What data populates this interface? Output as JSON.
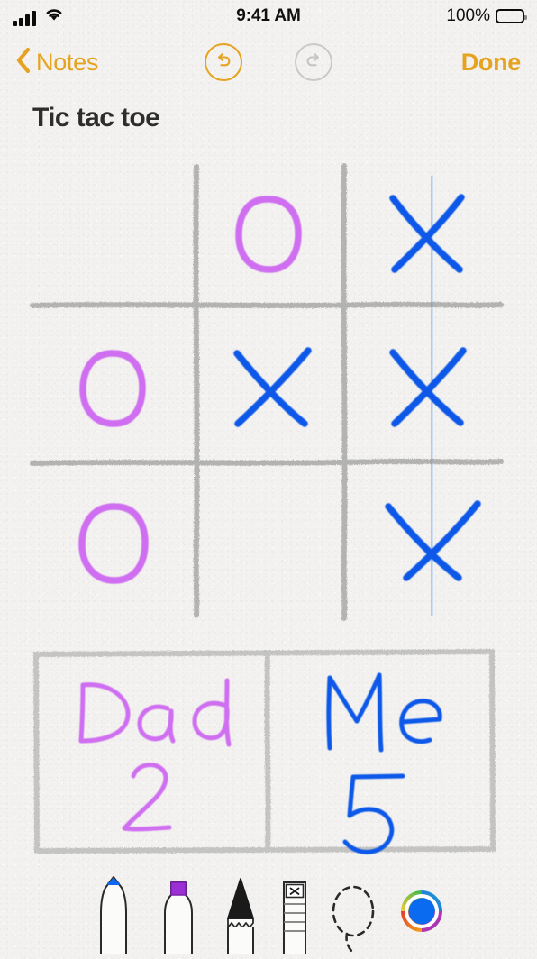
{
  "status_bar": {
    "cellular_icon": "signal-bars-icon",
    "signal_bars": 4,
    "wifi_icon": "wifi-icon",
    "time": "9:41 AM",
    "battery_percent": "100%",
    "battery_level": 100,
    "battery_icon": "battery-full-icon"
  },
  "nav_bar": {
    "back_icon": "chevron-left-icon",
    "back_label": "Notes",
    "undo_icon": "undo-arrow-icon",
    "undo_enabled": true,
    "redo_icon": "redo-arrow-icon",
    "redo_enabled": false,
    "done_label": "Done",
    "accent_color": "#e5a320",
    "disabled_color": "#c9c9c9"
  },
  "note": {
    "title": "Tic tac toe"
  },
  "drawing": {
    "ink_colors": {
      "pencil_gray": "#8d8d8d",
      "marker_purple": "#cf6ef0",
      "pen_blue": "#0a58e8",
      "highlight_blue": "#a8cbf6"
    },
    "board": {
      "rows": [
        [
          "",
          "O",
          "X"
        ],
        [
          "O",
          "X",
          "X"
        ],
        [
          "O",
          "",
          "X"
        ]
      ],
      "winning_line": "right-column",
      "winner_mark": "X"
    },
    "scoreboard": {
      "cells": [
        {
          "name": "Dad",
          "score": "2",
          "color": "#cf6ef0"
        },
        {
          "name": "Me",
          "score": "5",
          "color": "#0a58e8"
        }
      ]
    }
  },
  "tool_bar": {
    "tools": [
      {
        "name": "pen-tool",
        "label": "Pen",
        "tip_color": "#1166ee",
        "selected": true
      },
      {
        "name": "highlighter-tool",
        "label": "Highlighter",
        "tip_color": "#9b2fd4",
        "selected": false
      },
      {
        "name": "pencil-tool",
        "label": "Pencil",
        "tip_color": "#1a1a1a",
        "selected": false
      },
      {
        "name": "eraser-tool",
        "label": "Eraser",
        "tip_color": "#1a1a1a",
        "selected": false
      },
      {
        "name": "lasso-tool",
        "label": "Lasso",
        "tip_color": "#1a1a1a",
        "selected": false
      },
      {
        "name": "color-picker",
        "label": "Color",
        "tip_color": "#0a6bf0",
        "selected": false
      }
    ]
  }
}
